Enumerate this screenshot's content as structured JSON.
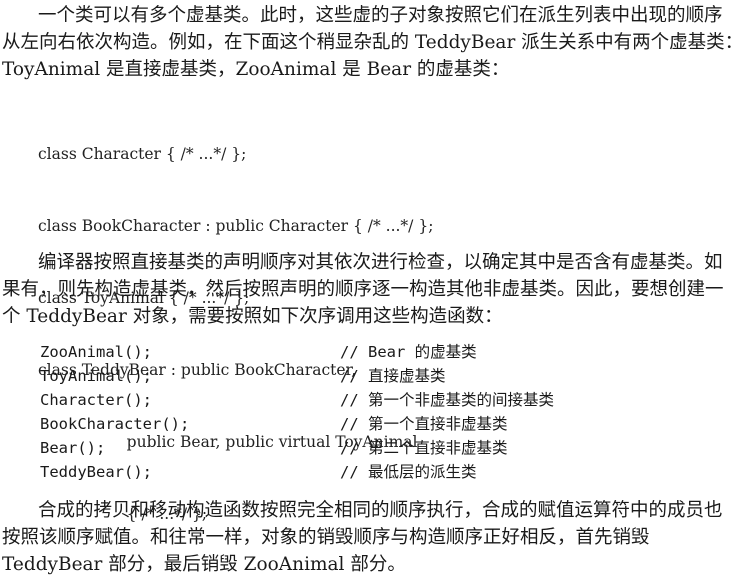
{
  "para1": {
    "line1": "一个类可以有多个虚基类。此时，这些虚的子对象按照它们在派生列表中出现的顺序",
    "line2": "从左向右依次构造。例如，在下面这个稍显杂乱的 TeddyBear 派生关系中有两个虚基类：",
    "line3": "ToyAnimal 是直接虚基类，ZooAnimal 是 Bear 的虚基类："
  },
  "code1": [
    "class Character { /* ...*/ };",
    "class BookCharacter : public Character { /* ...*/ };",
    "class ToyAnimal { /* ...*/ };",
    "class TeddyBear : public BookCharacter,",
    "                  public Bear, public virtual ToyAnimal",
    "                  { /* ...*/ };"
  ],
  "para2": {
    "line1": "编译器按照直接基类的声明顺序对其依次进行检查，以确定其中是否含有虚基类。如",
    "line2": "果有，则先构造虚基类，然后按照声明的顺序逐一构造其他非虚基类。因此，要想创建一",
    "line3": "个 TeddyBear 对象，需要按照如下次序调用这些构造函数："
  },
  "ctor_order": [
    {
      "call": "ZooAnimal();",
      "comment": "// Bear 的虚基类"
    },
    {
      "call": "ToyAnimal();",
      "comment": "// 直接虚基类"
    },
    {
      "call": "Character();",
      "comment": "// 第一个非虚基类的间接基类"
    },
    {
      "call": "BookCharacter();",
      "comment": "// 第一个直接非虚基类"
    },
    {
      "call": "Bear();",
      "comment": "// 第二个直接非虚基类"
    },
    {
      "call": "TeddyBear();",
      "comment": "// 最低层的派生类"
    }
  ],
  "para3": {
    "line1": "合成的拷贝和移动构造函数按照完全相同的顺序执行，合成的赋值运算符中的成员也",
    "line2": "按照该顺序赋值。和往常一样，对象的销毁顺序与构造顺序正好相反，首先销毁",
    "line3": "TeddyBear 部分，最后销毁 ZooAnimal 部分。"
  }
}
